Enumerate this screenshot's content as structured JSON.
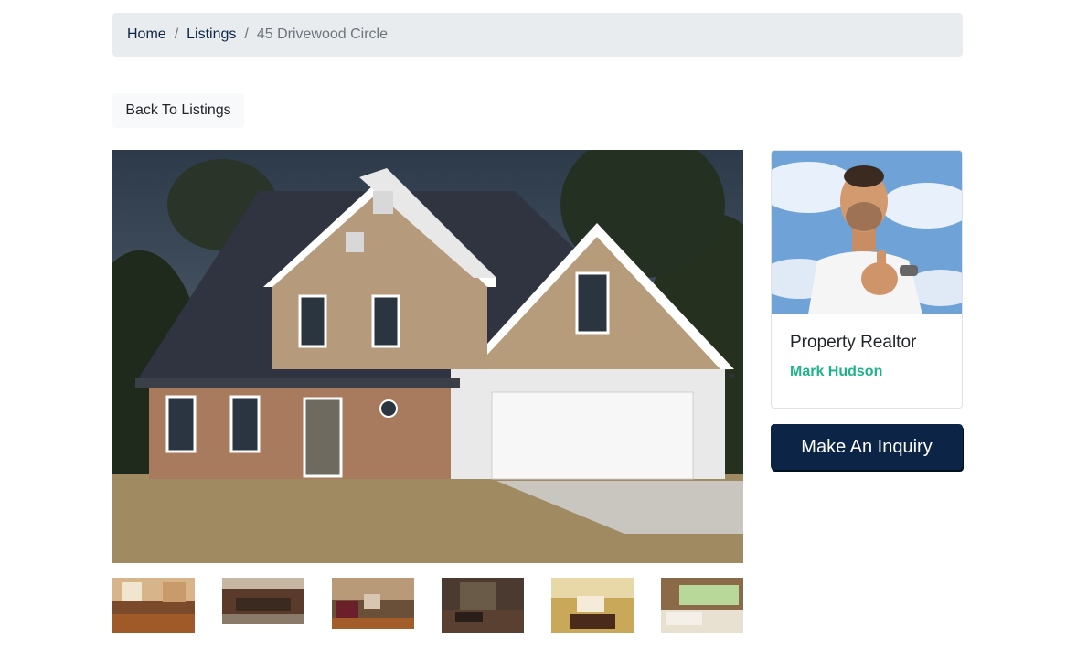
{
  "breadcrumb": {
    "home": "Home",
    "listings": "Listings",
    "current": "45 Drivewood Circle",
    "separator": "/"
  },
  "back_button": "Back To Listings",
  "listing_photo": {
    "alt": "45 Drivewood Circle"
  },
  "thumbnails": [
    {
      "alt": "Kitchen"
    },
    {
      "alt": "Living room"
    },
    {
      "alt": "Family room"
    },
    {
      "alt": "Dining room"
    },
    {
      "alt": "Game room"
    },
    {
      "alt": "Sunroom"
    }
  ],
  "realtor": {
    "title": "Property Realtor",
    "name": "Mark Hudson",
    "name_color": "#1fb38a"
  },
  "inquiry_button": "Make An Inquiry",
  "colors": {
    "primary": "#0c2445",
    "breadcrumb_bg": "#e9ecef",
    "accent": "#1fb38a"
  }
}
